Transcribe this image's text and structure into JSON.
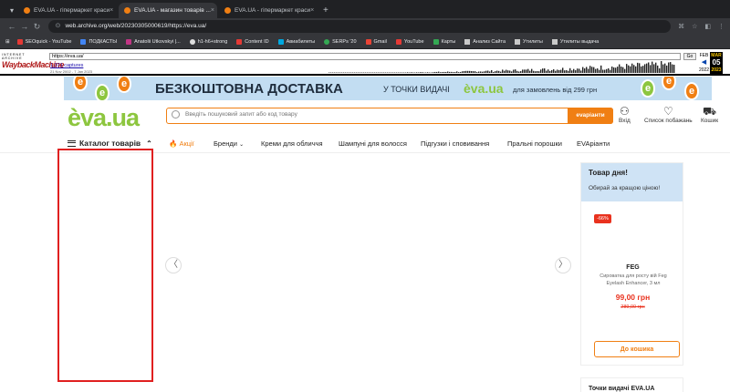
{
  "browser": {
    "tabs": [
      {
        "title": "EVA.UA - гіпермаркет краси",
        "active": false
      },
      {
        "title": "EVA.UA - магазин товарів ...",
        "active": true
      },
      {
        "title": "EVA.UA - гіпермаркет краси",
        "active": false
      }
    ],
    "url": "web.archive.org/web/20230305000619/https://eva.ua/",
    "bookmarks": [
      "SEOquick - YouTube",
      "ПОДКАСТЫ",
      "Anatolii Utkovskyi |...",
      "h1-h6+strong",
      "Content ID",
      "Авиабилеты",
      "SERPs '20",
      "Gmail",
      "YouTube",
      "Карты",
      "Анализ Сайта",
      "Утилиты",
      "Утилиты выдача"
    ]
  },
  "wayback": {
    "logo_top": "INTERNET ARCHIVE",
    "logo": "WaybackMachine",
    "url": "https://eva.ua/",
    "go": "Go",
    "captures": "1,371 captures",
    "range": "21 Nov 2002 - 7 Jan 2023",
    "cal": {
      "prev_month": "FEB",
      "month": "MAR",
      "next_month": "",
      "prev_year": "2022",
      "day": "05",
      "year": "2023"
    }
  },
  "banner": {
    "headline": "БЕЗКОШТОВНА ДОСТАВКА",
    "sub": "У ТОЧКИ ВИДАЧІ",
    "logo": "èva.ua",
    "tail": "для замовлень від 299 грн"
  },
  "header": {
    "logo": "èva.ua",
    "search_placeholder": "Введіть пошуковий запит або код товару",
    "search_button": "evaріанти",
    "login": "Вхід",
    "wishlist": "Список побажань",
    "cart": "Кошик"
  },
  "nav": {
    "catalog": "Каталог товарів",
    "links": [
      "Акції",
      "Бренди",
      "Креми для обличчя",
      "Шампуні для волосся",
      "Підгузки і сповивання",
      "Пральні порошки",
      "EVAріанти"
    ]
  },
  "deal": {
    "title": "Товар дня!",
    "subtitle": "Обирай за кращою ціною!",
    "badge": "-66%",
    "brand": "FEG",
    "product": "Сироватка для росту вій Feg Eyelash Enhancer, 3 мл",
    "price": "99,00 грн",
    "old_price": "289,00 грн",
    "button": "До кошика"
  },
  "next_section": {
    "title": "Точки видачі EVA.UA"
  },
  "colors": {
    "brand_green": "#8dc63f",
    "accent_orange": "#f07f13",
    "sale_red": "#e9321e",
    "banner_blue": "#c2ddf2"
  }
}
